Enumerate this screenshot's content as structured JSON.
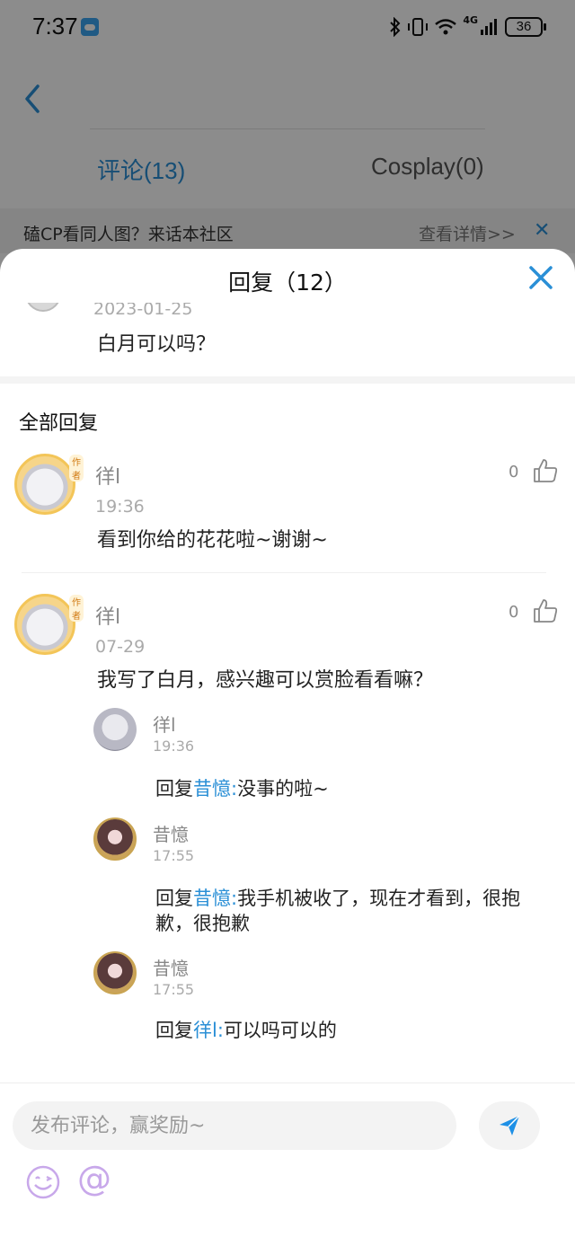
{
  "status_bar": {
    "time": "7:37",
    "network": "4G",
    "battery": "36"
  },
  "background": {
    "tabs": [
      {
        "label": "评论(13)",
        "active": true
      },
      {
        "label": "Cosplay(0)",
        "active": false
      }
    ],
    "banner": {
      "text": "磕CP看同人图？来话本社区",
      "link": "查看详情>>"
    }
  },
  "sheet": {
    "title": "回复（12）",
    "parent": {
      "date": "2023-01-25",
      "text": "白月可以吗？"
    },
    "section_title": "全部回复",
    "comments": [
      {
        "name": "徉l",
        "time": "19:36",
        "text": "看到你给的花花啦~谢谢~",
        "likes": "0",
        "badge": "作者"
      },
      {
        "name": "徉l",
        "time": "07-29",
        "text": "我写了白月，感兴趣可以赏脸看看嘛？",
        "likes": "0",
        "badge": "作者",
        "replies": [
          {
            "name": "徉l",
            "time": "19:36",
            "prefix": "回复",
            "mention": "昔憶:",
            "text": "没事的啦~"
          },
          {
            "name": "昔憶",
            "time": "17:55",
            "prefix": "回复",
            "mention": "昔憶:",
            "text": "我手机被收了，现在才看到，很抱歉，很抱歉"
          },
          {
            "name": "昔憶",
            "time": "17:55",
            "prefix": "回复",
            "mention": "徉l:",
            "text": "可以吗可以的"
          }
        ]
      }
    ]
  },
  "composer": {
    "placeholder": "发布评论，赢奖励~",
    "at_symbol": "@"
  },
  "colors": {
    "accent": "#2a8fd6",
    "send": "#1e90e6",
    "muted": "#888888",
    "emoji": "#c8a8ea"
  },
  "icons": [
    "back-icon",
    "close-icon",
    "like-icon",
    "send-icon",
    "emoji-icon",
    "weather-icon",
    "bluetooth-icon",
    "wifi-icon",
    "signal-icon",
    "battery-icon"
  ]
}
